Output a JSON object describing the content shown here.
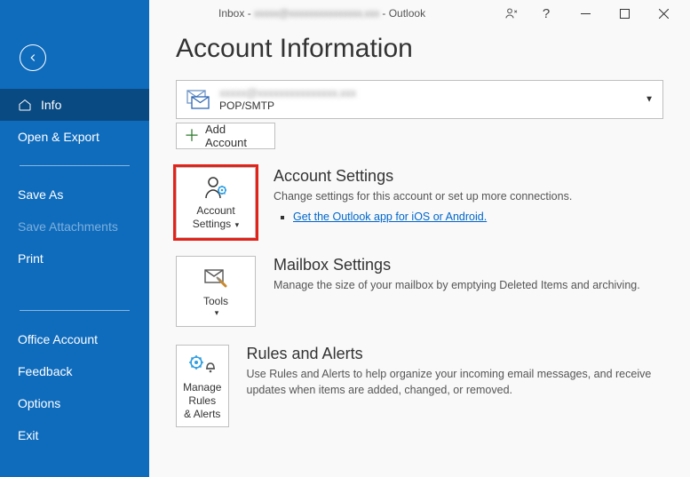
{
  "titlebar": {
    "text_prefix": "Inbox - ",
    "email_obscured": "xxxxx@xxxxxxxxxxxxxxx.xxx",
    "text_suffix": " - Outlook"
  },
  "page": {
    "heading": "Account Information"
  },
  "sidebar": {
    "info": "Info",
    "open_export": "Open & Export",
    "save_as": "Save As",
    "save_attachments": "Save Attachments",
    "print": "Print",
    "office_account": "Office Account",
    "feedback": "Feedback",
    "options": "Options",
    "exit": "Exit"
  },
  "account_selector": {
    "email_obscured": "xxxxx@xxxxxxxxxxxxxxx.xxx",
    "account_type": "POP/SMTP"
  },
  "add_account": {
    "label": "Add Account"
  },
  "sections": {
    "account_settings": {
      "btn_line1": "Account",
      "btn_line2": "Settings",
      "heading": "Account Settings",
      "desc": "Change settings for this account or set up more connections.",
      "link": "Get the Outlook app for iOS or Android."
    },
    "mailbox_settings": {
      "btn_label": "Tools",
      "heading": "Mailbox Settings",
      "desc": "Manage the size of your mailbox by emptying Deleted Items and archiving."
    },
    "rules_alerts": {
      "btn_line1": "Manage Rules",
      "btn_line2": "& Alerts",
      "heading": "Rules and Alerts",
      "desc": "Use Rules and Alerts to help organize your incoming email messages, and receive updates when items are added, changed, or removed."
    }
  }
}
